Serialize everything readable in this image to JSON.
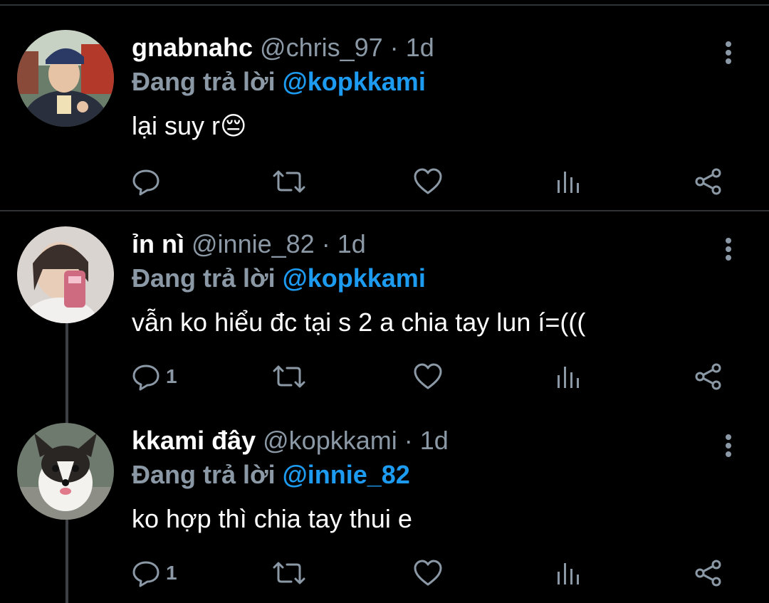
{
  "tweets": [
    {
      "name": "gnabnahc",
      "handle": "@chris_97",
      "separator": "·",
      "time": "1d",
      "reply_prefix": "Đang trả lời",
      "reply_to": "@kopkkami",
      "text": "lại suy r",
      "emoji": "😔",
      "reply_count": "",
      "avatar_icon": "user-avatar-photo"
    },
    {
      "name": "ỉn nì",
      "handle": "@innie_82",
      "separator": "·",
      "time": "1d",
      "reply_prefix": "Đang trả lời",
      "reply_to": "@kopkkami",
      "text": "vẫn ko hiểu đc tại s 2 a chia tay lun í=(((",
      "emoji": "",
      "reply_count": "1",
      "avatar_icon": "user-avatar-photo"
    },
    {
      "name": "kkami đây",
      "handle": "@kopkkami",
      "separator": "·",
      "time": "1d",
      "reply_prefix": "Đang trả lời",
      "reply_to": "@innie_82",
      "text": "ko hợp thì chia tay thui e",
      "emoji": "",
      "reply_count": "1",
      "avatar_icon": "dog-avatar-photo"
    }
  ],
  "colors": {
    "background": "#000000",
    "muted": "#8b98a5",
    "accent": "#1d9bf0",
    "divider": "#2f3336"
  }
}
